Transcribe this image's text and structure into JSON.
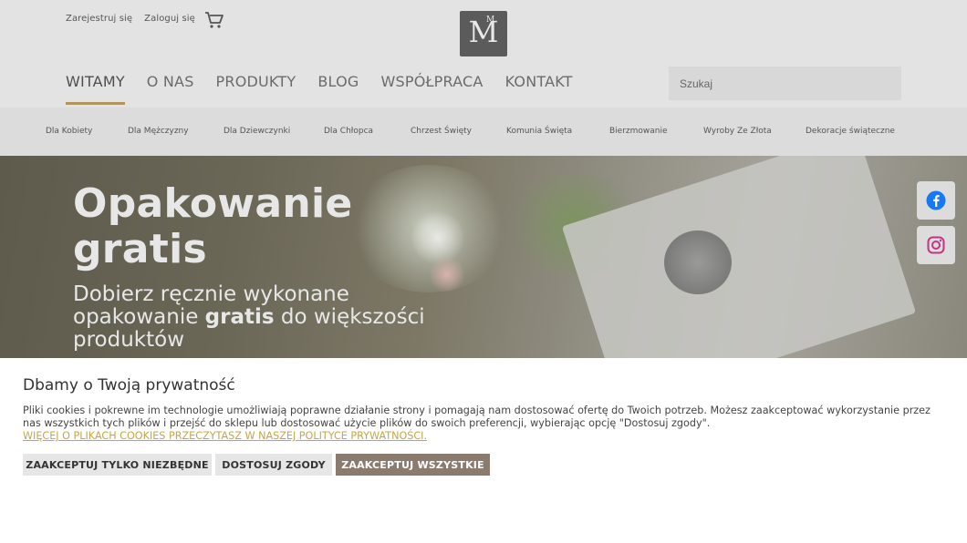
{
  "header": {
    "register_label": "Zarejestruj się",
    "login_label": "Zaloguj się",
    "logo_big": "M",
    "logo_small": "M",
    "search_placeholder": "Szukaj"
  },
  "nav": {
    "items": [
      "WITAMY",
      "O NAS",
      "PRODUKTY",
      "BLOG",
      "WSPÓŁPRACA",
      "KONTAKT"
    ],
    "active": "WITAMY"
  },
  "categories": [
    "Dla Kobiety",
    "Dla Mężczyzny",
    "Dla Dziewczynki",
    "Dla Chłopca",
    "Chrzest Święty",
    "Komunia Święta",
    "Bierzmowanie",
    "Wyroby Ze Złota",
    "Dekoracje świąteczne"
  ],
  "hero": {
    "title_line1": "Opakowanie",
    "title_line2": "gratis",
    "sub_part1": "Dobierz ręcznie wykonane opakowanie ",
    "sub_bold": "gratis",
    "sub_part2": " do większości produktów"
  },
  "social": {
    "icons": [
      "facebook-icon",
      "instagram-icon"
    ],
    "facebook_color": "#1877f2",
    "instagram_color": "#c13584"
  },
  "cookie": {
    "title": "Dbamy o Twoją prywatność",
    "text": "Pliki cookies i pokrewne im technologie umożliwiają poprawne działanie strony i pomagają nam dostosować ofertę do Twoich potrzeb. Możesz zaakceptować wykorzystanie przez nas wszystkich tych plików i przejść do sklepu lub dostosować użycie plików do swoich preferencji, wybierając opcję \"Dostosuj zgody\".",
    "more_link": "WIĘCEJ O PLIKACH COOKIES PRZECZYTASZ W NASZEJ POLITYCE PRYWATNOŚCI.",
    "btn_necessary": "ZAAKCEPTUJ TYLKO NIEZBĘDNE",
    "btn_customize": "DOSTOSUJ ZGODY",
    "btn_accept_all": "ZAAKCEPTUJ WSZYSTKIE"
  },
  "colors": {
    "accent": "#b2955c",
    "primary_button": "#8b7b6f",
    "link": "#c4a54a"
  }
}
